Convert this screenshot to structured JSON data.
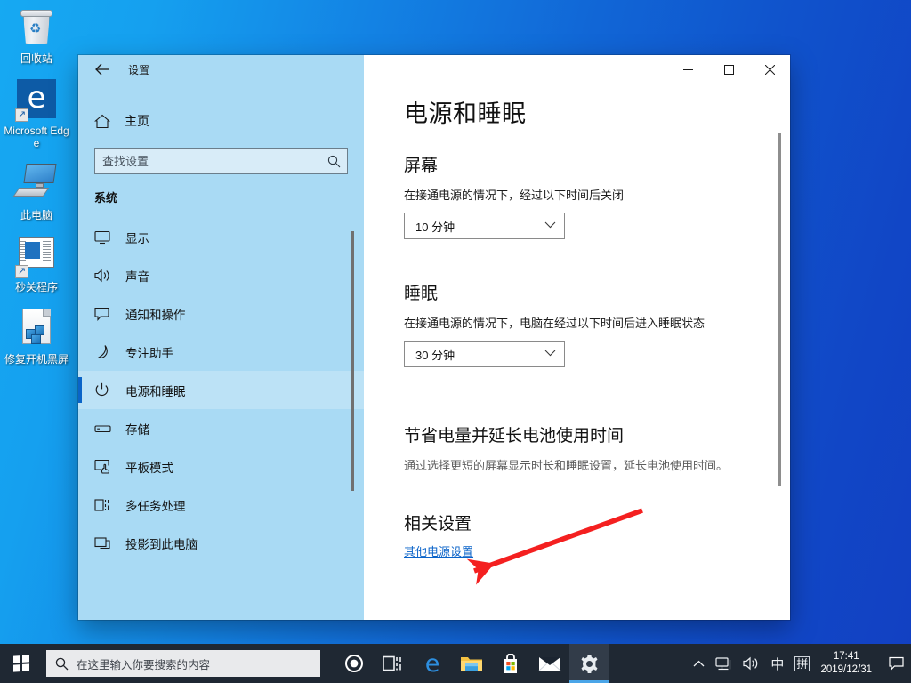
{
  "desktop": {
    "icons": [
      {
        "label": "回收站",
        "icon": "recycle-bin-icon"
      },
      {
        "label": "Microsoft Edge",
        "icon": "microsoft-edge-icon"
      },
      {
        "label": "此电脑",
        "icon": "this-pc-icon"
      },
      {
        "label": "秒关程序",
        "icon": "app-shortcut-icon"
      },
      {
        "label": "修复开机黑屏",
        "icon": "document-shortcut-icon"
      }
    ]
  },
  "window": {
    "title": "设置",
    "back_icon": "back-arrow-icon",
    "controls": {
      "minimize": "—",
      "maximize": "□",
      "close": "✕"
    }
  },
  "sidebar": {
    "home_label": "主页",
    "home_icon": "home-icon",
    "search": {
      "placeholder": "查找设置",
      "value": "",
      "icon": "search-icon"
    },
    "group_title": "系统",
    "items": [
      {
        "label": "显示",
        "icon": "monitor-icon",
        "selected": false
      },
      {
        "label": "声音",
        "icon": "speaker-icon",
        "selected": false
      },
      {
        "label": "通知和操作",
        "icon": "notification-icon",
        "selected": false
      },
      {
        "label": "专注助手",
        "icon": "moon-icon",
        "selected": false
      },
      {
        "label": "电源和睡眠",
        "icon": "power-icon",
        "selected": true
      },
      {
        "label": "存储",
        "icon": "storage-icon",
        "selected": false
      },
      {
        "label": "平板模式",
        "icon": "tablet-icon",
        "selected": false
      },
      {
        "label": "多任务处理",
        "icon": "multitask-icon",
        "selected": false
      },
      {
        "label": "投影到此电脑",
        "icon": "project-icon",
        "selected": false
      }
    ]
  },
  "main": {
    "page_title": "电源和睡眠",
    "screen_section": {
      "heading": "屏幕",
      "description": "在接通电源的情况下，经过以下时间后关闭",
      "dropdown_value": "10 分钟",
      "dropdown_icon": "chevron-down-icon"
    },
    "sleep_section": {
      "heading": "睡眠",
      "description": "在接通电源的情况下，电脑在经过以下时间后进入睡眠状态",
      "dropdown_value": "30 分钟",
      "dropdown_icon": "chevron-down-icon"
    },
    "battery_section": {
      "heading": "节省电量并延长电池使用时间",
      "description": "通过选择更短的屏幕显示时长和睡眠设置，延长电池使用时间。"
    },
    "related_section": {
      "heading": "相关设置",
      "link_label": "其他电源设置"
    }
  },
  "annotation": {
    "arrow_color": "#f42020",
    "type": "red-arrow"
  },
  "taskbar": {
    "start_icon": "windows-start-icon",
    "search": {
      "placeholder": "在这里输入你要搜索的内容",
      "icon": "search-icon"
    },
    "apps": [
      {
        "name": "cortana-icon",
        "active": false
      },
      {
        "name": "task-view-icon",
        "active": false
      },
      {
        "name": "microsoft-edge-icon",
        "active": false
      },
      {
        "name": "file-explorer-icon",
        "active": false
      },
      {
        "name": "microsoft-store-icon",
        "active": false
      },
      {
        "name": "mail-icon",
        "active": false
      },
      {
        "name": "settings-icon",
        "active": true
      }
    ],
    "tray": [
      {
        "name": "show-hidden-icons",
        "glyph": "∧"
      },
      {
        "name": "network-icon",
        "glyph": "network"
      },
      {
        "name": "volume-icon",
        "glyph": "volume"
      },
      {
        "name": "ime-mode-icon",
        "glyph": "中"
      },
      {
        "name": "ime-pinyin-icon",
        "glyph": "拼"
      }
    ],
    "clock": {
      "time": "17:41",
      "date": "2019/12/31"
    },
    "action_center_icon": "action-center-icon"
  },
  "colors": {
    "accent": "#0a64c8",
    "link": "#0a63c9",
    "sidebar_bg": "#a9daf4",
    "taskbar_bg": "#1f2833",
    "annotation_red": "#f42020"
  }
}
